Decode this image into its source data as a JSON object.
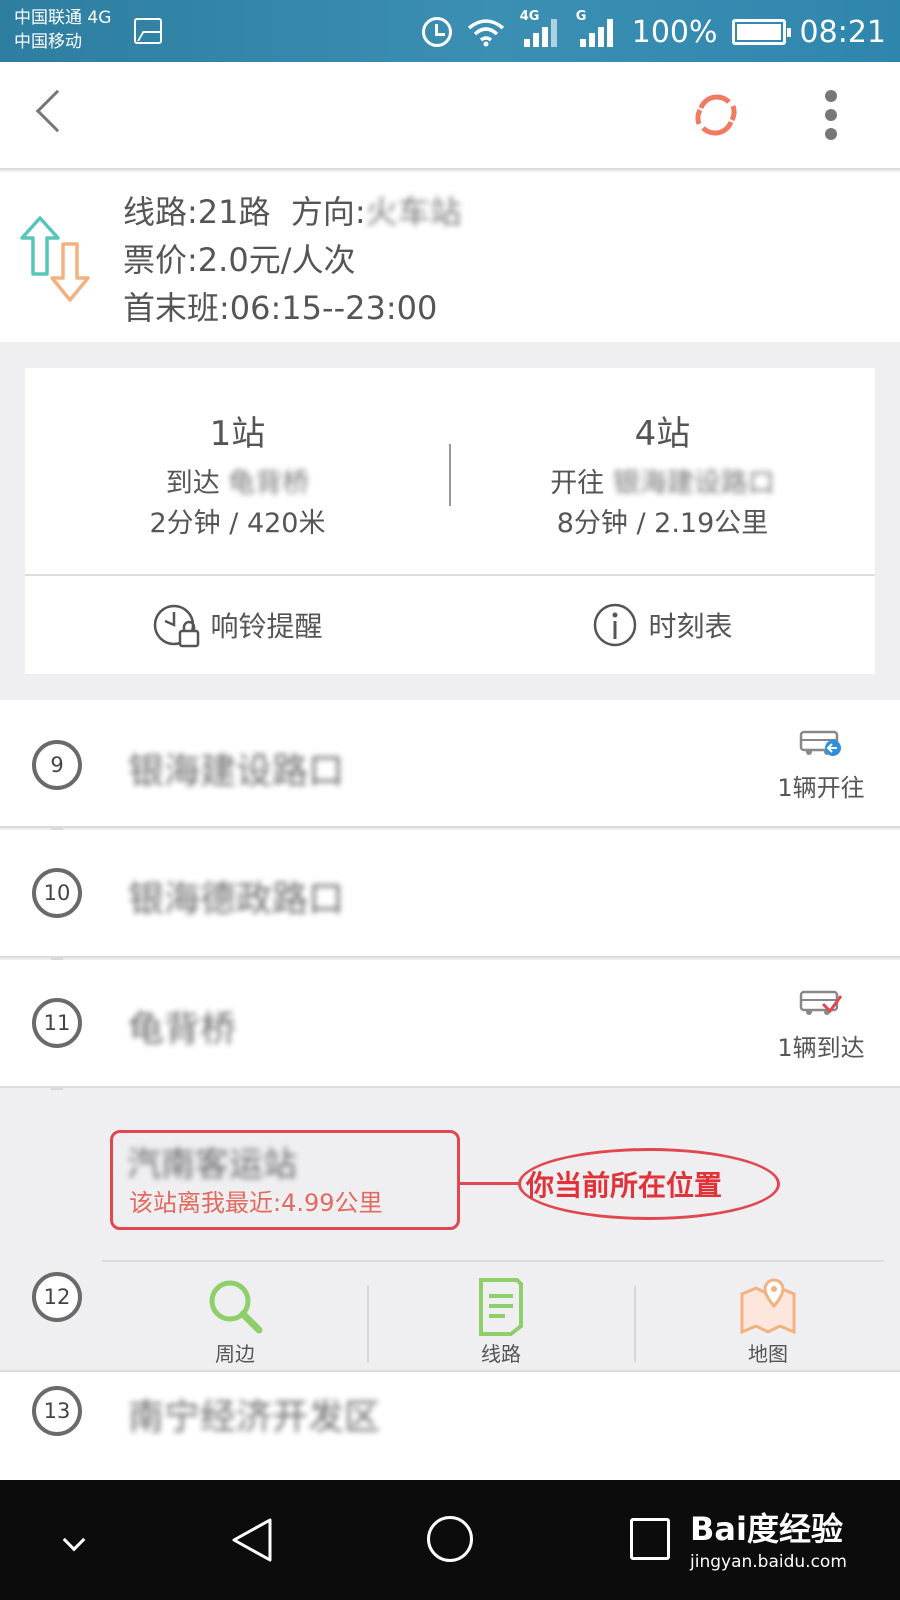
{
  "status_bar": {
    "carrier1": "中国联通 4G",
    "carrier2": "中国移动",
    "net1": "4G",
    "net2": "G",
    "battery": "100%",
    "time": "08:21"
  },
  "route": {
    "line_label": "线路:",
    "line_value": "21路",
    "direction_label": "方向:",
    "direction_value": "火车站",
    "fare_label": "票价:",
    "fare_value": "2.0元/人次",
    "schedule_label": "首末班:",
    "schedule_value": "06:15--23:00"
  },
  "summary": {
    "left": {
      "stops": "1站",
      "prefix": "到达",
      "station": "龟背桥",
      "detail": "2分钟 / 420米"
    },
    "right": {
      "stops": "4站",
      "prefix": "开往",
      "station": "银海建设路口",
      "detail": "8分钟 / 2.19公里"
    },
    "ring_reminder": "响铃提醒",
    "timetable": "时刻表"
  },
  "stations": [
    {
      "num": "9",
      "name": "银海建设路口",
      "bus_note": "1辆开往"
    },
    {
      "num": "10",
      "name": "银海德政路口",
      "bus_note": ""
    },
    {
      "num": "11",
      "name": "龟背桥",
      "bus_note": "1辆到达"
    }
  ],
  "current_station": {
    "num": "12",
    "name": "汽南客运站",
    "distance": "该站离我最近:4.99公里",
    "annotation": "你当前所在位置",
    "actions": [
      "周边",
      "线路",
      "地图"
    ]
  },
  "next_station": {
    "num": "13",
    "name": "南宁经济开发区"
  },
  "watermark": {
    "logo": "Bai度经验",
    "url": "jingyan.baidu.com"
  },
  "colors": {
    "status_bar": "#3388ad",
    "accent_red": "#e0474f",
    "refresh": "#f07b62",
    "green": "#8fcf6b",
    "teal": "#56c6b8",
    "orange": "#f2b27f"
  }
}
